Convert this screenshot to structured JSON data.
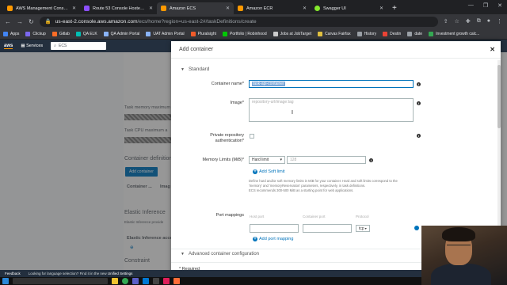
{
  "browser": {
    "tabs": [
      {
        "title": "AWS Management Console",
        "color": "#ff9900"
      },
      {
        "title": "Route 53 Console Hosted Zone",
        "color": "#8c4fff"
      },
      {
        "title": "Amazon ECS",
        "color": "#ff9900",
        "active": true
      },
      {
        "title": "Amazon ECR",
        "color": "#ff9900"
      },
      {
        "title": "Swagger UI",
        "color": "#85ea2d"
      }
    ],
    "url_host": "us-east-2.console.aws.amazon.com",
    "url_path": "/ecs/home?region=us-east-2#/taskDefinitions/create",
    "bookmarks": [
      "Apps",
      "Clickup",
      "Gitlab",
      "QA ELK",
      "QA Admin Portal",
      "UAT Admin Portal",
      "Pluralsight",
      "Portfolio | Robinhood",
      "Jobs at JobTarget",
      "Carvas Fairfax",
      "History",
      "Destin",
      "date",
      "Investment growth calc..."
    ]
  },
  "aws_nav": {
    "logo": "aws",
    "services": "Services",
    "search": "ECS"
  },
  "background": {
    "task_memory_label": "Task memory maximum",
    "task_cpu_label": "Task CPU maximum a",
    "container_definitions": "Container definition",
    "add_container_btn": "Add container",
    "col1": "Container ...",
    "col2": "Imag",
    "elastic_inference": "Elastic Inference",
    "elastic_inference_desc": "Elastic Inference provide",
    "elastic_inference_col": "Elastic Inference acce",
    "constraint": "Constraint"
  },
  "modal": {
    "title": "Add container",
    "section": "Standard",
    "container_name_label": "Container name*",
    "container_name_value": "task-api-container",
    "image_label": "Image*",
    "image_placeholder": "repository-url/image:tag",
    "private_repo_label": "Private repository authentication*",
    "memory_label": "Memory Limits (MiB)*",
    "memory_select": "Hard limit",
    "memory_value": "128",
    "add_soft_limit": "Add Soft limit",
    "memory_help_1": "Define hard and/or soft memory limits in MiB for your container. Hard and soft limits correspond to the",
    "memory_help_2": "'memory' and 'memoryReservation' parameters, respectively, in task definitions.",
    "memory_help_3": "ECS recommends 300-500 MiB as a starting point for web applications.",
    "port_label": "Port mappings",
    "port_host_col": "Host port",
    "port_container_col": "Container port",
    "port_protocol_col": "Protocol",
    "port_protocol_value": "tcp",
    "add_port": "Add port mapping",
    "advanced": "Advanced container configuration",
    "required_note": "* Required"
  },
  "footer": {
    "feedback": "Feedback",
    "language_text": "Looking for language selection? Find it in the new",
    "unified_settings": "Unified Settings"
  }
}
